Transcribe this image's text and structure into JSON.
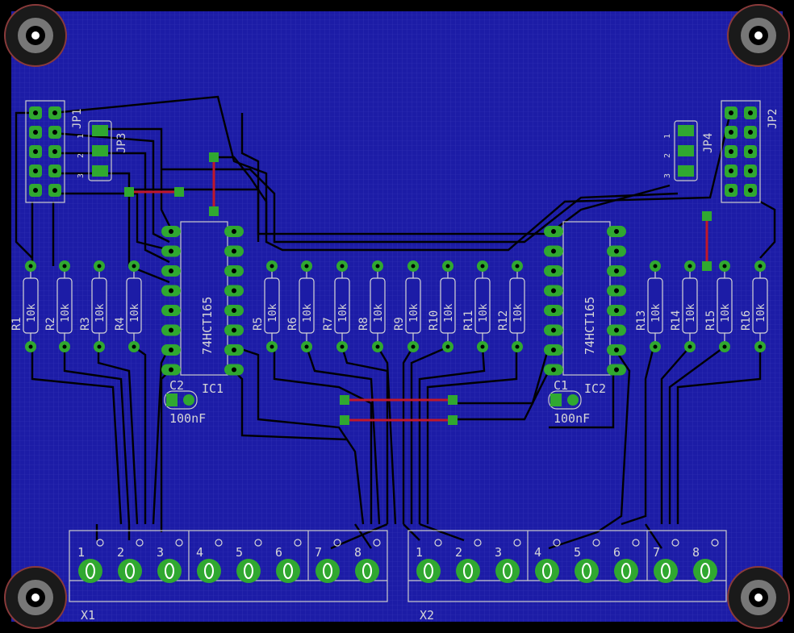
{
  "colors": {
    "board": "#1a1aa0",
    "grid": "#3a3ac0",
    "trace": "#000000",
    "pad": "#30a830",
    "silk": "#d6d6d6",
    "via": "#c0182a"
  },
  "resistors": {
    "left": [
      "R1",
      "R2",
      "R3",
      "R4"
    ],
    "middle": [
      "R5",
      "R6",
      "R7",
      "R8",
      "R9",
      "R10",
      "R11",
      "R12"
    ],
    "right": [
      "R13",
      "R14",
      "R15",
      "R16"
    ],
    "value": "10k"
  },
  "ics": [
    {
      "name": "IC1",
      "part": "74HCT165"
    },
    {
      "name": "IC2",
      "part": "74HCT165"
    }
  ],
  "caps": [
    {
      "name": "C2",
      "value": "100nF"
    },
    {
      "name": "C1",
      "value": "100nF"
    }
  ],
  "jumpers": {
    "jp1": "JP1",
    "jp2": "JP2",
    "jp3": "JP3",
    "jp4": "JP4",
    "pins": [
      "1",
      "2",
      "3"
    ]
  },
  "connectors": [
    {
      "name": "X1",
      "pins": [
        "1",
        "2",
        "3",
        "4",
        "5",
        "6",
        "7",
        "8"
      ]
    },
    {
      "name": "X2",
      "pins": [
        "1",
        "2",
        "3",
        "4",
        "5",
        "6",
        "7",
        "8"
      ]
    }
  ]
}
